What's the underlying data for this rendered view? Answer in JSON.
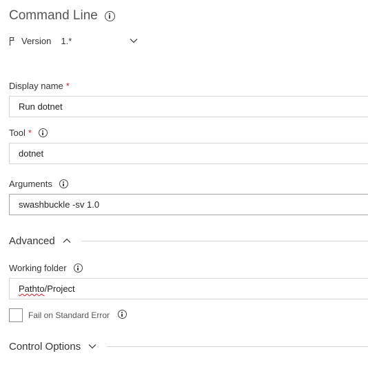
{
  "task": {
    "title": "Command Line",
    "version_label": "Version",
    "version_value": "1.*"
  },
  "fields": {
    "display_name": {
      "label": "Display name",
      "required_mark": "*",
      "value": "Run dotnet"
    },
    "tool": {
      "label": "Tool",
      "required_mark": "*",
      "value": "dotnet"
    },
    "arguments": {
      "label": "Arguments",
      "value": "swashbuckle -sv 1.0"
    }
  },
  "advanced": {
    "label": "Advanced",
    "working_folder": {
      "label": "Working folder",
      "value_part1": "Pathto",
      "value_part2": "/Project"
    },
    "fail_on_stderr": {
      "label": "Fail on Standard Error",
      "checked": false
    }
  },
  "control_options": {
    "label": "Control Options"
  },
  "colors": {
    "required": "#c4262e",
    "border": "#d4d4d4",
    "focused_border": "#a6a6a6",
    "spell_underline": "#e81123"
  },
  "icons": [
    "info-icon",
    "flag-icon",
    "chevron-down-icon",
    "chevron-up-icon"
  ]
}
